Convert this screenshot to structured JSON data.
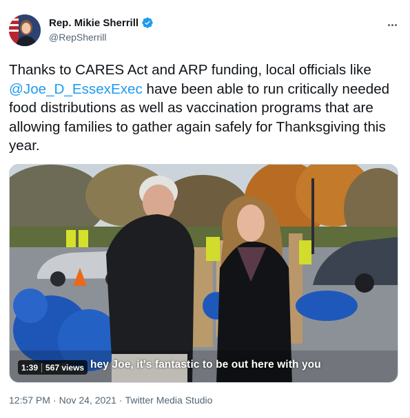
{
  "author": {
    "display_name": "Rep. Mikie Sherrill",
    "handle": "@RepSherrill",
    "verified": true,
    "avatar": "profile-photo"
  },
  "tweet": {
    "text_before": "Thanks to CARES Act and ARP funding, local officials like ",
    "mention": "@Joe_D_EssexExec",
    "text_after": " have been able to run critically needed food distributions as well as vaccination programs that are allowing families to gather again safely for Thanksgiving this year."
  },
  "media": {
    "duration": "1:39",
    "views": "567 views",
    "caption": "hey Joe, it's fantastic to be out here with you"
  },
  "meta": {
    "time": "12:57 PM",
    "separator": "·",
    "date": "Nov 24, 2021",
    "source": "Twitter Media Studio"
  },
  "icons": {
    "verified": "verified-badge-icon",
    "more": "more-options-icon"
  },
  "colors": {
    "accent": "#1d9bf0",
    "secondary_text": "#536471",
    "primary_text": "#0f1419"
  }
}
